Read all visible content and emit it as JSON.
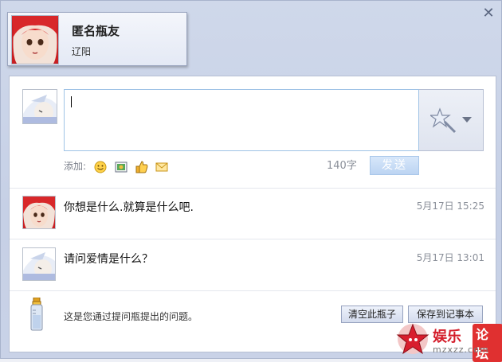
{
  "header": {
    "name": "匿名瓶友",
    "location": "辽阳",
    "close_icon": "close-icon"
  },
  "compose": {
    "add_label": "添加:",
    "char_count": "140字",
    "send_label": "发送",
    "icons": [
      "smiley-icon",
      "image-icon",
      "thumbs-up-icon",
      "envelope-icon"
    ],
    "emote_icon": "magic-wand-star-icon"
  },
  "messages": [
    {
      "text": "你想是什么.就算是什么吧.",
      "time": "5月17日 15:25",
      "avatar": "red-hair-girl-avatar"
    },
    {
      "text": "请问爱情是什么？",
      "time": "5月17日 13:01",
      "avatar": "white-hair-avatar"
    }
  ],
  "footer": {
    "note": "这是您通过提问瓶提出的问题。",
    "clear_label": "清空此瓶子",
    "save_label": "保存到记事本"
  },
  "watermark": {
    "title": "娱乐",
    "badge": "论坛",
    "url": "mzxzz.com"
  }
}
